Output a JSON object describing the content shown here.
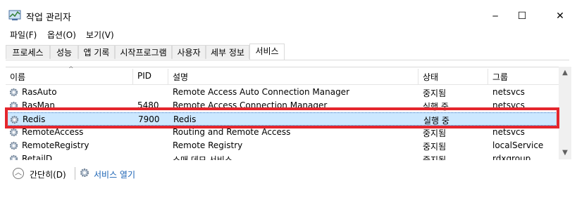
{
  "window": {
    "title": "작업 관리자",
    "controls": {
      "minimize": "─",
      "maximize": "☐",
      "close": "✕"
    }
  },
  "menu": [
    "파일(F)",
    "옵션(O)",
    "보기(V)"
  ],
  "tabs": [
    {
      "label": "프로세스",
      "active": false
    },
    {
      "label": "성능",
      "active": false
    },
    {
      "label": "앱 기록",
      "active": false
    },
    {
      "label": "시작프로그램",
      "active": false
    },
    {
      "label": "사용자",
      "active": false
    },
    {
      "label": "세부 정보",
      "active": false
    },
    {
      "label": "서비스",
      "active": true
    }
  ],
  "table": {
    "columns": [
      "이름",
      "PID",
      "설명",
      "상태",
      "그룹"
    ],
    "sort_arrow": "^",
    "rows": [
      {
        "name": "RasAuto",
        "pid": "",
        "desc": "Remote Access Auto Connection Manager",
        "status": "중지됨",
        "group": "netsvcs"
      },
      {
        "name": "RasMan",
        "pid": "5480",
        "desc": "Remote Access Connection Manager",
        "status": "실행 중",
        "group": "netsvcs"
      },
      {
        "name": "Redis",
        "pid": "7900",
        "desc": "Redis",
        "status": "실행 중",
        "group": ""
      },
      {
        "name": "RemoteAccess",
        "pid": "",
        "desc": "Routing and Remote Access",
        "status": "중지됨",
        "group": "netsvcs"
      },
      {
        "name": "RemoteRegistry",
        "pid": "",
        "desc": "Remote Registry",
        "status": "중지됨",
        "group": "localService"
      },
      {
        "name": "RetailD",
        "pid": "",
        "desc": "소매 데모 서비스",
        "status": "중지됨",
        "group": "rdxgroup"
      }
    ]
  },
  "footer": {
    "collapse_label": "간단히(D)",
    "open_services_label": "서비스 열기"
  },
  "colors": {
    "highlight": "#e4262d",
    "selected": "#cce8ff",
    "link": "#1a62b4"
  }
}
